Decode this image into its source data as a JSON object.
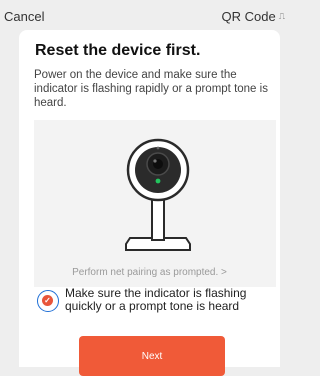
{
  "header": {
    "cancel_label": "Cancel",
    "qr_label": "QR Code",
    "qr_icon": "qr-scan-icon"
  },
  "main": {
    "title": "Reset the device first.",
    "description": "Power on the device and make sure the indicator is flashing rapidly or a prompt tone is heard.",
    "illustration": "camera-device-illustration",
    "hint_link": "Perform net pairing as prompted. >",
    "confirm_checkbox": {
      "checked": true,
      "label": "Make sure the indicator is flashing quickly or a prompt tone is heard"
    },
    "next_label": "Next"
  },
  "colors": {
    "accent": "#f05a38",
    "background": "#eeeeee",
    "card": "#ffffff",
    "focus_ring": "#1f6fd6"
  }
}
